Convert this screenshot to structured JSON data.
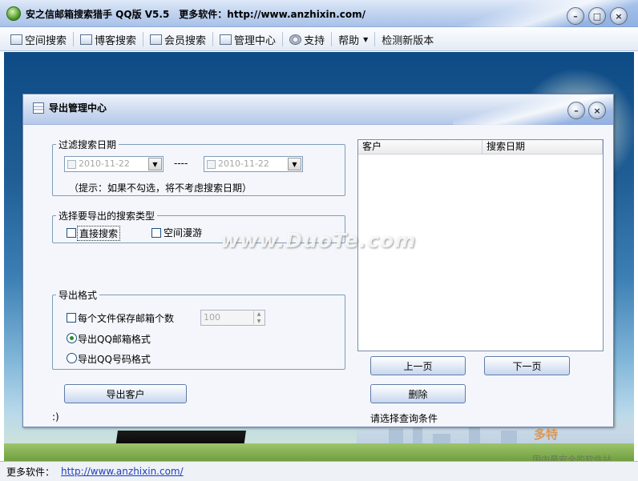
{
  "app": {
    "title": "安之信邮箱搜索猎手 QQ版 V5.5　更多软件：http://www.anzhixin.com/",
    "minimize_label": "–",
    "maximize_label": "□",
    "close_label": "×"
  },
  "toolbar": {
    "items": [
      {
        "label": "空间搜索",
        "icon": "window-icon"
      },
      {
        "label": "博客搜索",
        "icon": "window-icon"
      },
      {
        "label": "会员搜索",
        "icon": "add-member-icon"
      },
      {
        "label": "管理中心",
        "icon": "window-icon"
      },
      {
        "label": "支持",
        "icon": "gear-icon"
      },
      {
        "label": "帮助",
        "icon": "chevron-down-icon"
      },
      {
        "label": "检测新版本",
        "icon": ""
      }
    ]
  },
  "dialog": {
    "title": "导出管理中心",
    "date_filter": {
      "legend": "过滤搜索日期",
      "from_date": "2010-11-22",
      "separator": "----",
      "to_date": "2010-11-22",
      "hint": "（提示：如果不勾选，将不考虑搜索日期）"
    },
    "search_type": {
      "legend": "选择要导出的搜索类型",
      "options": [
        {
          "label": "直接搜索",
          "checked": false
        },
        {
          "label": "空间漫游",
          "checked": false
        }
      ]
    },
    "export_format": {
      "legend": "导出格式",
      "per_file_label": "每个文件保存邮箱个数",
      "per_file_value": "100",
      "per_file_checked": false,
      "format_email": "导出QQ邮箱格式",
      "format_number": "导出QQ号码格式",
      "selected": "email"
    },
    "export_button": "导出客户",
    "status_left": ":)",
    "list": {
      "columns": [
        "客户",
        "搜索日期"
      ],
      "rows": []
    },
    "prev_page": "上一页",
    "next_page": "下一页",
    "delete": "删除",
    "query_hint": "请选择查询条件"
  },
  "watermark": "www.DuoTe.com",
  "corner_watermark": {
    "text": "多特",
    "sub": "国内最安全的软件站"
  },
  "statusbar": {
    "label": "更多软件：",
    "link": "http://www.anzhixin.com/"
  },
  "colors": {
    "accent": "#6f88b3",
    "button_border": "#5f7ca9",
    "link": "#1f3fbf",
    "radio_selected": "#2a8f2a"
  }
}
